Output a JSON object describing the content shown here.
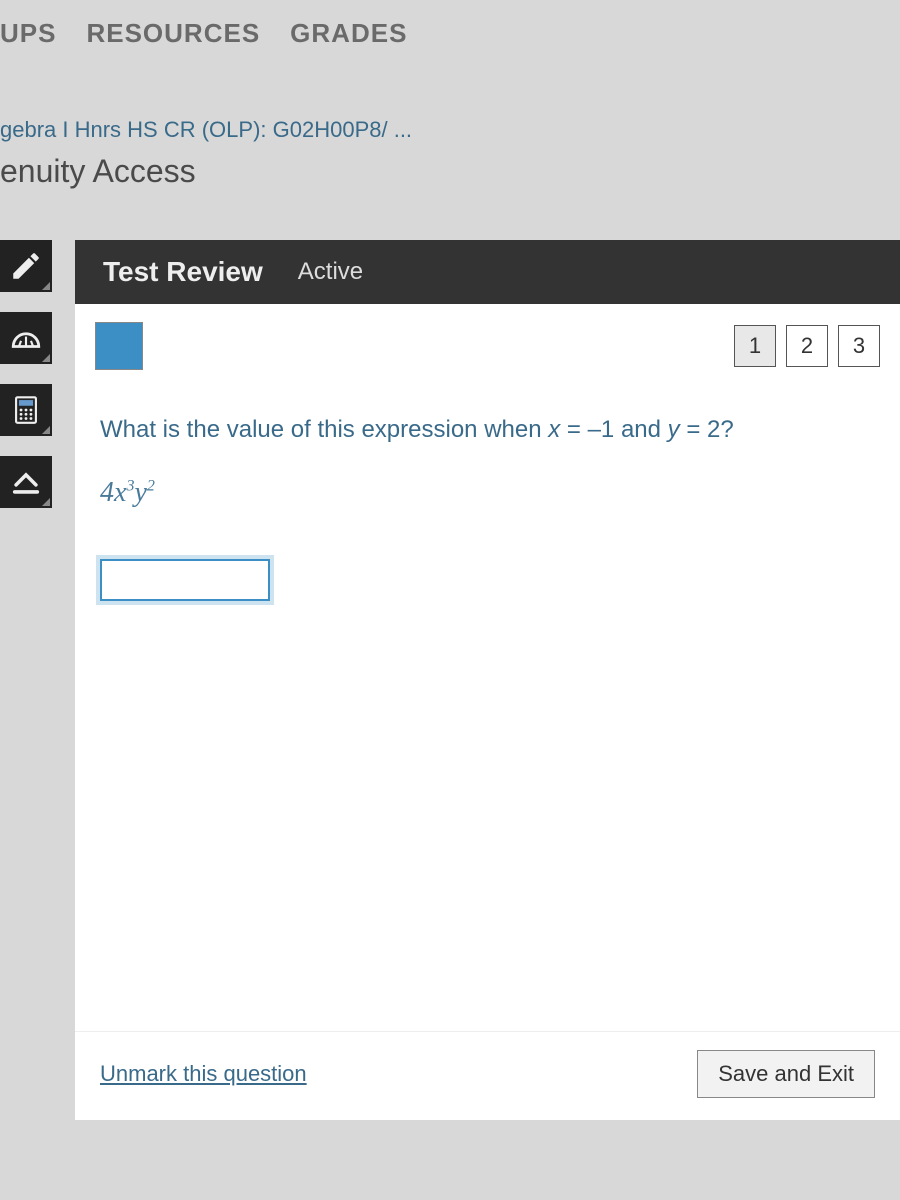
{
  "nav": {
    "groups": "UPS",
    "resources": "RESOURCES",
    "grades": "GRADES"
  },
  "breadcrumb": "gebra I Hnrs HS CR (OLP): G02H00P8/ ...",
  "page_title": "enuity Access",
  "panel": {
    "review_title": "Test Review",
    "active_label": "Active"
  },
  "question_nav": [
    "1",
    "2",
    "3"
  ],
  "question": {
    "prompt_prefix": "What is the value of this expression when ",
    "x_var": "x",
    "x_eq": " = –1 and ",
    "y_var": "y",
    "y_eq": " = 2?",
    "expr_coef": "4",
    "expr_x": "x",
    "expr_x_pow": "3",
    "expr_y": "y",
    "expr_y_pow": "2"
  },
  "footer": {
    "unmark": "Unmark this question",
    "save_exit": "Save and Exit"
  }
}
